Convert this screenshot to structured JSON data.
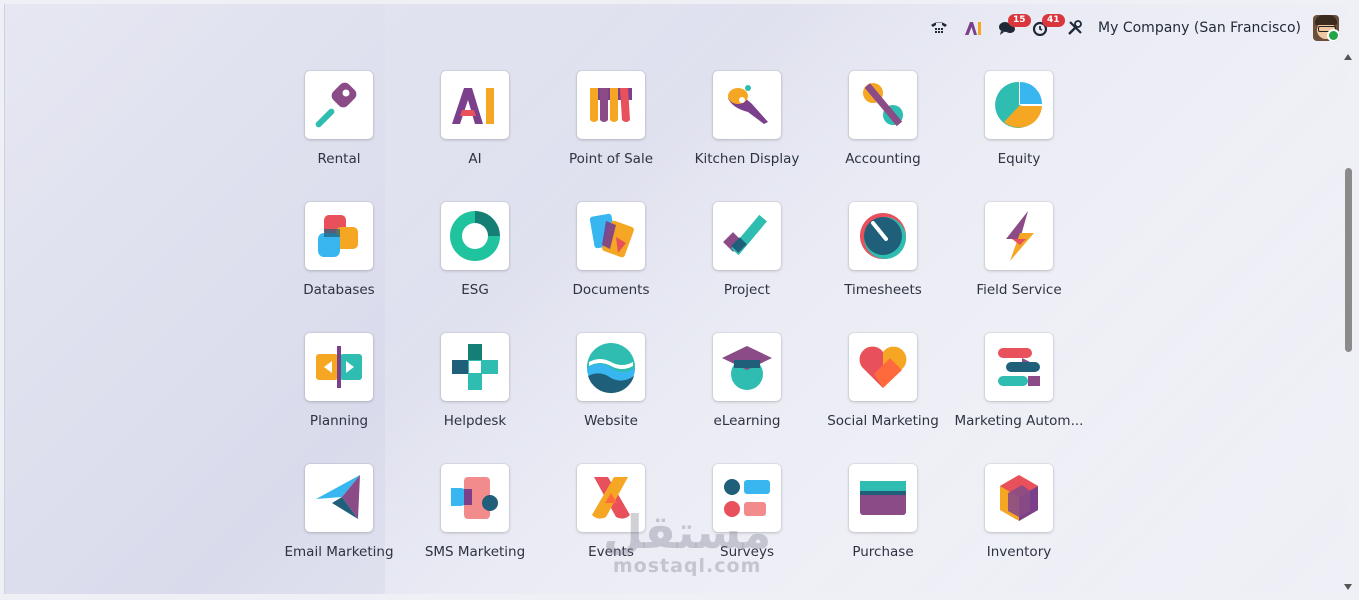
{
  "topbar": {
    "company": "My Company (San Francisco)",
    "messages_count": "15",
    "activities_count": "41"
  },
  "apps": [
    {
      "label": "Rental",
      "icon": "rental-icon"
    },
    {
      "label": "AI",
      "icon": "ai-icon"
    },
    {
      "label": "Point of Sale",
      "icon": "point-of-sale-icon"
    },
    {
      "label": "Kitchen Display",
      "icon": "kitchen-display-icon"
    },
    {
      "label": "Accounting",
      "icon": "accounting-icon"
    },
    {
      "label": "Equity",
      "icon": "equity-icon"
    },
    {
      "label": "Databases",
      "icon": "databases-icon"
    },
    {
      "label": "ESG",
      "icon": "esg-icon"
    },
    {
      "label": "Documents",
      "icon": "documents-icon"
    },
    {
      "label": "Project",
      "icon": "project-icon"
    },
    {
      "label": "Timesheets",
      "icon": "timesheets-icon"
    },
    {
      "label": "Field Service",
      "icon": "field-service-icon"
    },
    {
      "label": "Planning",
      "icon": "planning-icon"
    },
    {
      "label": "Helpdesk",
      "icon": "helpdesk-icon"
    },
    {
      "label": "Website",
      "icon": "website-icon"
    },
    {
      "label": "eLearning",
      "icon": "elearning-icon"
    },
    {
      "label": "Social Marketing",
      "icon": "social-marketing-icon"
    },
    {
      "label": "Marketing Autom...",
      "icon": "marketing-automation-icon"
    },
    {
      "label": "Email Marketing",
      "icon": "email-marketing-icon"
    },
    {
      "label": "SMS Marketing",
      "icon": "sms-marketing-icon"
    },
    {
      "label": "Events",
      "icon": "events-icon"
    },
    {
      "label": "Surveys",
      "icon": "surveys-icon"
    },
    {
      "label": "Purchase",
      "icon": "purchase-icon"
    },
    {
      "label": "Inventory",
      "icon": "inventory-icon"
    }
  ],
  "watermark": {
    "arabic": "مستقل",
    "latin": "mostaql.com"
  }
}
